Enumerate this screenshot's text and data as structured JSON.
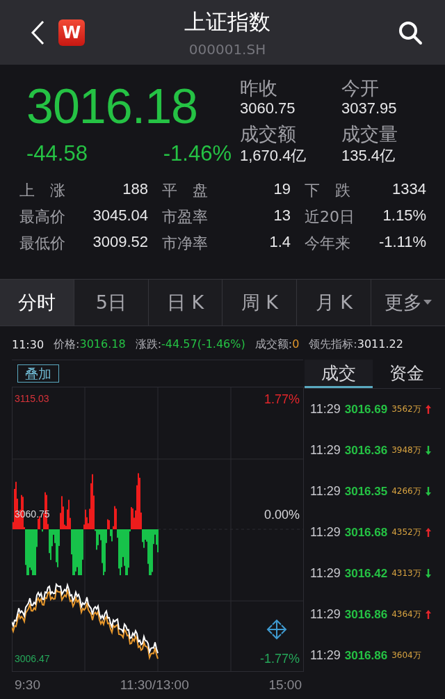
{
  "header": {
    "logo": "W",
    "title": "上证指数",
    "code": "000001.SH"
  },
  "quote": {
    "price": "3016.18",
    "change": "-44.58",
    "change_pct": "-1.46%",
    "falling": true,
    "fields": [
      {
        "label": "昨收",
        "value": "3060.75"
      },
      {
        "label": "今开",
        "value": "3037.95"
      },
      {
        "label": "成交额",
        "value": "1,670.4亿"
      },
      {
        "label": "成交量",
        "value": "135.4亿"
      }
    ]
  },
  "stats": [
    {
      "label": "上　涨",
      "value": "188"
    },
    {
      "label": "平　盘",
      "value": "19"
    },
    {
      "label": "下　跌",
      "value": "1334"
    },
    {
      "label": "最高价",
      "value": "3045.04"
    },
    {
      "label": "市盈率",
      "value": "13"
    },
    {
      "label": "近20日",
      "value": "1.15%"
    },
    {
      "label": "最低价",
      "value": "3009.52"
    },
    {
      "label": "市净率",
      "value": "1.4"
    },
    {
      "label": "今年来",
      "value": "-1.11%"
    }
  ],
  "tabs": [
    {
      "label": "分时",
      "selected": true,
      "kind": "tab"
    },
    {
      "label": "5日",
      "selected": false,
      "kind": "tab"
    },
    {
      "label": "日 K",
      "selected": false,
      "kind": "tab"
    },
    {
      "label": "周 K",
      "selected": false,
      "kind": "tab"
    },
    {
      "label": "月 K",
      "selected": false,
      "kind": "tab"
    },
    {
      "label": "更多",
      "selected": false,
      "kind": "dropdown"
    }
  ],
  "info_bar": {
    "time": "11:30",
    "items": [
      {
        "label": "价格:",
        "value": "3016.18",
        "color": "#25c244"
      },
      {
        "label": "涨跌:",
        "value": "-44.57(-1.46%)",
        "color": "#25c244"
      },
      {
        "label": "成交额:",
        "value": "0",
        "color": "#e0962a"
      },
      {
        "label": "领先指标:",
        "value": "3011.22",
        "color": "#e8e8ea"
      }
    ]
  },
  "chart": {
    "overlay_button": "叠加",
    "top_price": "3115.03",
    "mid_price": "3060.75",
    "bottom_price": "3006.47",
    "top_pct": "1.77%",
    "mid_pct": "0.00%",
    "bottom_pct": "-1.77%",
    "x_labels": [
      "9:30",
      "11:30/13:00",
      "15:00"
    ]
  },
  "trades": {
    "tabs": [
      {
        "label": "成交",
        "selected": true
      },
      {
        "label": "资金",
        "selected": false
      }
    ],
    "rows": [
      {
        "time": "11:29",
        "price": "3016.69",
        "volume": "3562万",
        "kind": "up"
      },
      {
        "time": "11:29",
        "price": "3016.36",
        "volume": "3948万",
        "kind": "down"
      },
      {
        "time": "11:29",
        "price": "3016.35",
        "volume": "4266万",
        "kind": "down"
      },
      {
        "time": "11:29",
        "price": "3016.68",
        "volume": "4352万",
        "kind": "up"
      },
      {
        "time": "11:29",
        "price": "3016.42",
        "volume": "4313万",
        "kind": "down"
      },
      {
        "time": "11:29",
        "price": "3016.86",
        "volume": "4364万",
        "kind": "up"
      },
      {
        "time": "11:29",
        "price": "3016.86",
        "volume": "3604万",
        "kind": "plain"
      }
    ]
  }
}
